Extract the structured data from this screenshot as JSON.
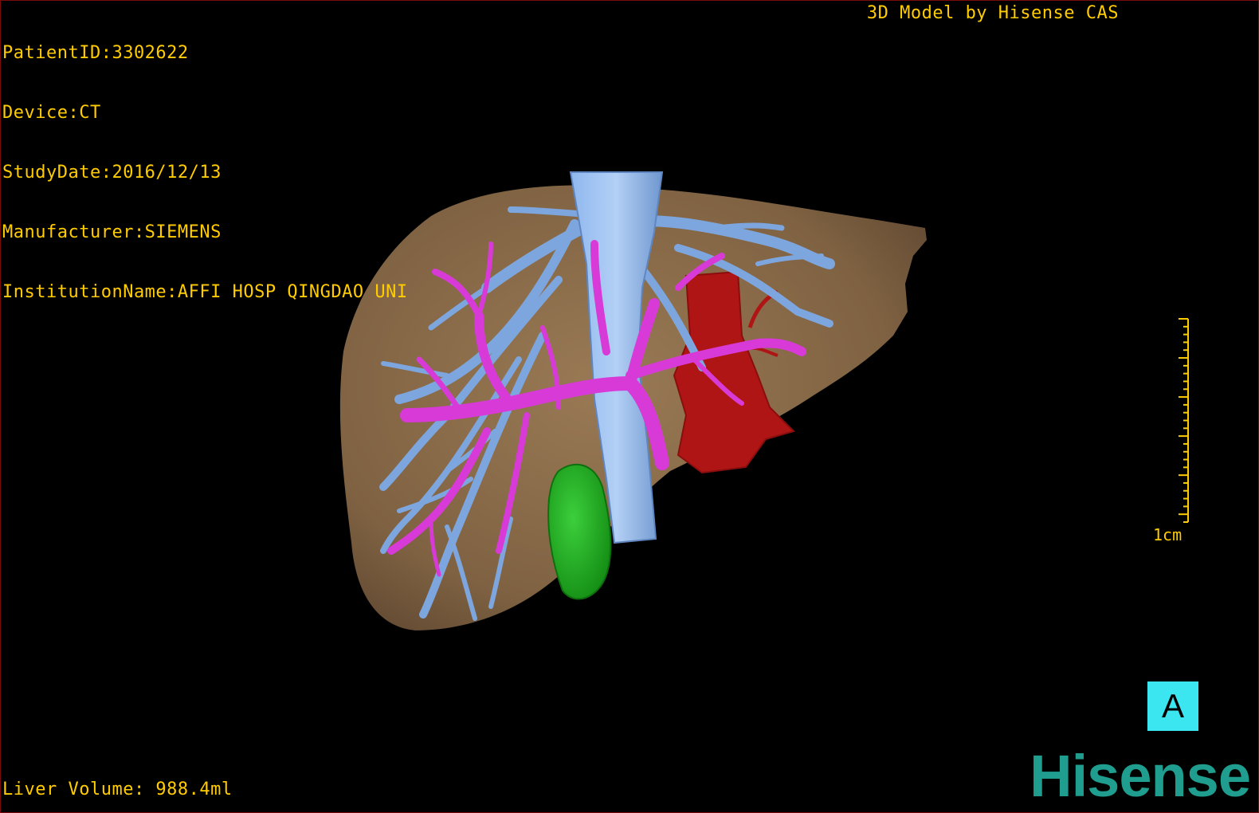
{
  "header": {
    "patient_id": "PatientID:3302622",
    "device": "Device:CT",
    "study_date": "StudyDate:2016/12/13",
    "manufacturer": "Manufacturer:SIEMENS",
    "institution": "InstitutionName:AFFI HOSP QINGDAO UNI",
    "credit": "3D Model by Hisense CAS"
  },
  "footer": {
    "liver_volume": "Liver Volume: 988.4ml"
  },
  "scale": {
    "label": "1cm"
  },
  "orientation": {
    "label": "A"
  },
  "brand": {
    "logo_text": "Hisense"
  },
  "colors": {
    "overlay_text": "#ffcc00",
    "liver": "#8a6b48",
    "hepatic_vein": "#7ea6de",
    "portal_vein": "#d83ad8",
    "artery": "#b01515",
    "gallbladder": "#1faa1f",
    "orientation_box": "#3ce6f0",
    "logo": "#1f9d8f"
  }
}
